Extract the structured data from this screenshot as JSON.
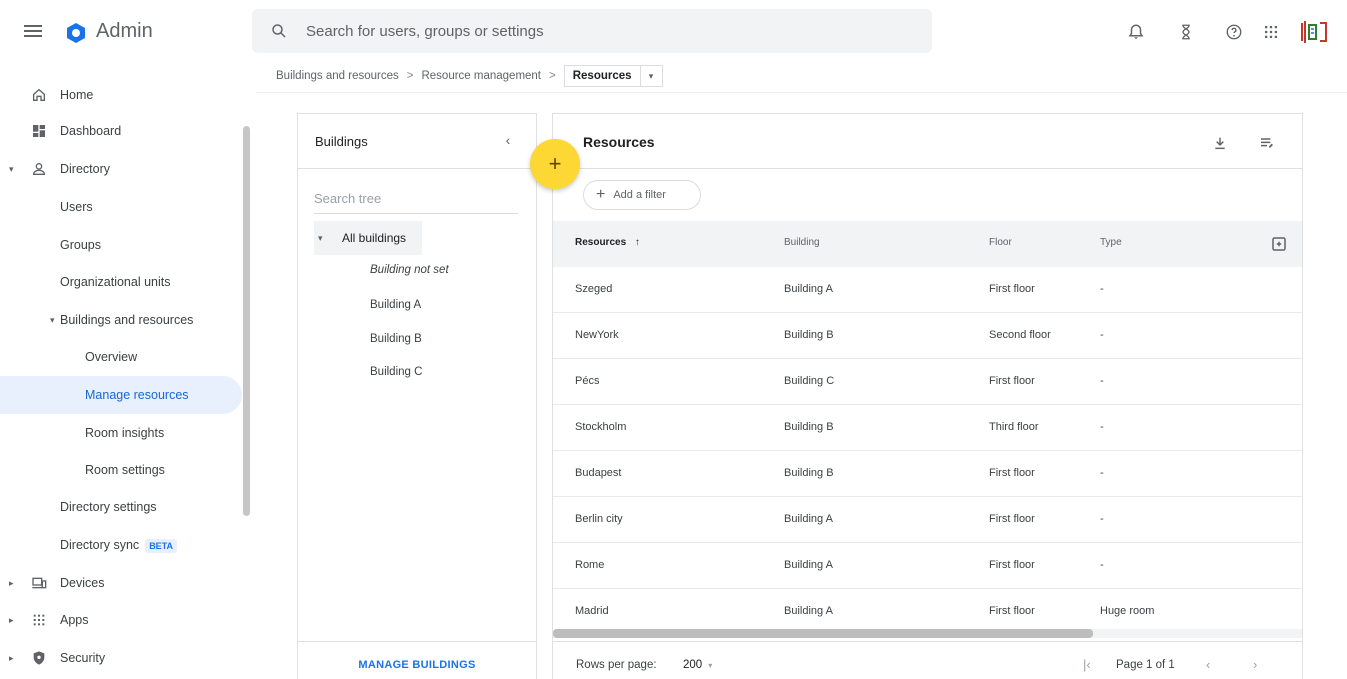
{
  "app": {
    "title": "Admin"
  },
  "search": {
    "placeholder": "Search for users, groups or settings"
  },
  "top_icons": [
    "bell-icon",
    "hourglass-icon",
    "help-icon",
    "apps-grid-icon",
    "account-avatar"
  ],
  "sidebar": {
    "items": [
      {
        "label": "Home",
        "icon": "home-icon"
      },
      {
        "label": "Dashboard",
        "icon": "dashboard-icon"
      },
      {
        "label": "Directory",
        "icon": "person-icon",
        "expanded": true
      },
      {
        "label": "Users"
      },
      {
        "label": "Groups"
      },
      {
        "label": "Organizational units"
      },
      {
        "label": "Buildings and resources",
        "expanded": true
      },
      {
        "label": "Overview"
      },
      {
        "label": "Manage resources",
        "active": true
      },
      {
        "label": "Room insights"
      },
      {
        "label": "Room settings"
      },
      {
        "label": "Directory settings"
      },
      {
        "label": "Directory sync",
        "badge": "BETA"
      },
      {
        "label": "Devices",
        "icon": "devices-icon"
      },
      {
        "label": "Apps",
        "icon": "apps-icon"
      },
      {
        "label": "Security",
        "icon": "shield-icon"
      }
    ]
  },
  "breadcrumb": {
    "items": [
      "Buildings and resources",
      "Resource management"
    ],
    "separator": ">",
    "current": "Resources"
  },
  "buildings": {
    "title": "Buildings",
    "search_placeholder": "Search tree",
    "root": "All buildings",
    "children": [
      "Building not set",
      "Building A",
      "Building B",
      "Building C"
    ],
    "manage_label": "MANAGE BUILDINGS"
  },
  "fab": {
    "label": "+"
  },
  "resources": {
    "title": "Resources",
    "filter_label": "Add a filter",
    "columns": [
      "Resources",
      "Building",
      "Floor",
      "Type"
    ],
    "rows": [
      {
        "name": "Szeged",
        "building": "Building A",
        "floor": "First floor",
        "type": "-"
      },
      {
        "name": "NewYork",
        "building": "Building B",
        "floor": "Second floor",
        "type": "-"
      },
      {
        "name": "Pécs",
        "building": "Building C",
        "floor": "First floor",
        "type": "-"
      },
      {
        "name": "Stockholm",
        "building": "Building B",
        "floor": "Third floor",
        "type": "-"
      },
      {
        "name": "Budapest",
        "building": "Building B",
        "floor": "First floor",
        "type": "-"
      },
      {
        "name": "Berlin city",
        "building": "Building A",
        "floor": "First floor",
        "type": "-"
      },
      {
        "name": "Rome",
        "building": "Building A",
        "floor": "First floor",
        "type": "-"
      },
      {
        "name": "Madrid",
        "building": "Building A",
        "floor": "First floor",
        "type": "Huge room"
      }
    ],
    "rows_per_page_label": "Rows per page:",
    "rows_per_page": "200",
    "page_label": "Page 1 of 1"
  },
  "colors": {
    "accent": "#1a73e8",
    "active_bg": "#e8f0fe",
    "fab": "#fdd835",
    "header_bg": "#f1f3f4"
  }
}
